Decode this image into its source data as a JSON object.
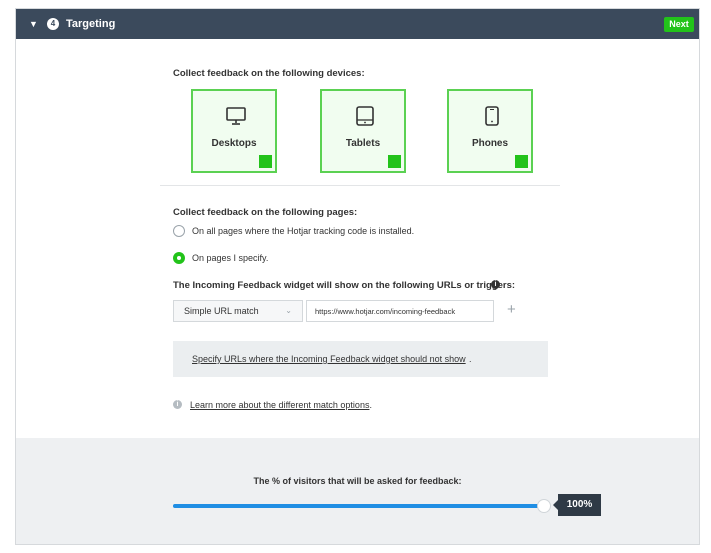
{
  "header": {
    "step_number": "4",
    "title": "Targeting",
    "next_label": "Next"
  },
  "devices": {
    "heading": "Collect feedback on the following devices:",
    "items": [
      {
        "label": "Desktops",
        "icon": "desktop-icon",
        "checked": true
      },
      {
        "label": "Tablets",
        "icon": "tablet-icon",
        "checked": true
      },
      {
        "label": "Phones",
        "icon": "phone-icon",
        "checked": true
      }
    ]
  },
  "pages": {
    "heading": "Collect feedback on the following pages:",
    "option_all": "On all pages where the Hotjar tracking code is installed.",
    "option_specify": "On pages I specify.",
    "selected": "option_specify",
    "urls_heading": "The Incoming Feedback widget will show on the following URLs or triggers:",
    "match_type": "Simple URL match",
    "url_value": "https://www.hotjar.com/incoming-feedback",
    "exclude_link": "Specify URLs where the Incoming Feedback widget should not show",
    "learn_more_link": "Learn more about the different match options"
  },
  "visitors": {
    "label": "The % of visitors that will be asked for feedback:",
    "percent": 100,
    "value_text": "100%"
  },
  "colors": {
    "header_bg": "#3b4a5c",
    "accent_green": "#22c31a",
    "slider_blue": "#1f8ee4"
  }
}
